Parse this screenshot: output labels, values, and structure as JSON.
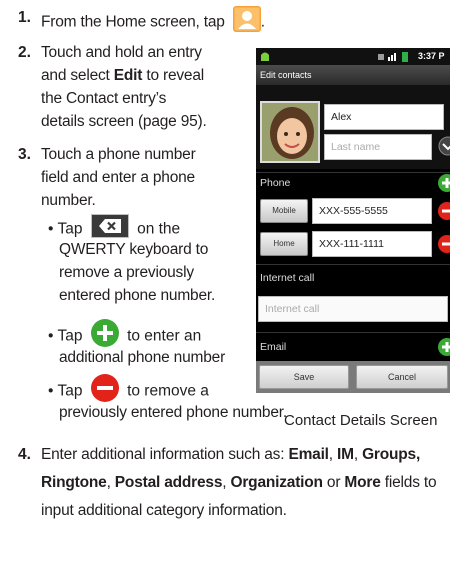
{
  "steps": {
    "s1": {
      "num": "1.",
      "text_before": "From the Home screen, tap",
      "text_after": "."
    },
    "s2": {
      "num": "2.",
      "lines": [
        "Touch and hold an entry",
        "and select ",
        "Edit",
        " to reveal",
        "the Contact entry’s",
        "details screen (page 95)."
      ]
    },
    "s3": {
      "num": "3.",
      "lines": [
        "Touch a phone number",
        "field and enter a phone",
        "number."
      ]
    },
    "b1": {
      "tap": "Tap",
      "after": "on the",
      "lines": [
        "QWERTY keyboard to",
        "remove a previously",
        "entered phone number."
      ]
    },
    "b2": {
      "tap": "Tap",
      "after": "to enter an",
      "line2": "additional phone number"
    },
    "b3": {
      "tap": "Tap",
      "after": "to remove a",
      "line2": "previously entered phone number."
    },
    "s4": {
      "num": "4.",
      "l1_pre": "Enter additional information such as: ",
      "email": "Email",
      "c1": ", ",
      "im": "IM",
      "c2": ", ",
      "groups": "Groups,",
      "ringtone": "Ringtone",
      "c3": ", ",
      "postal": "Postal address",
      "c4": ", ",
      "org": "Organization",
      "or": " or ",
      "more": "More",
      "l2_post": " fields to",
      "l3": "input additional category information."
    }
  },
  "phone": {
    "time": "3:37 P",
    "title": "Edit contacts",
    "first_name": "Alex",
    "last_name_placeholder": "Last name",
    "phone_section": "Phone",
    "rows": [
      {
        "type": "Mobile",
        "number": "XXX-555-5555"
      },
      {
        "type": "Home",
        "number": "XXX-111-1111"
      }
    ],
    "internet_section": "Internet call",
    "internet_placeholder": "Internet call",
    "email_section": "Email",
    "save": "Save",
    "cancel": "Cancel"
  },
  "caption": "Contact Details Screen",
  "colors": {
    "add": "#3aaa35",
    "remove": "#e2231a",
    "accent_green": "#2fae4a"
  },
  "icons": [
    "contacts-icon",
    "backspace-key-icon",
    "add-circle-icon",
    "remove-circle-icon"
  ]
}
